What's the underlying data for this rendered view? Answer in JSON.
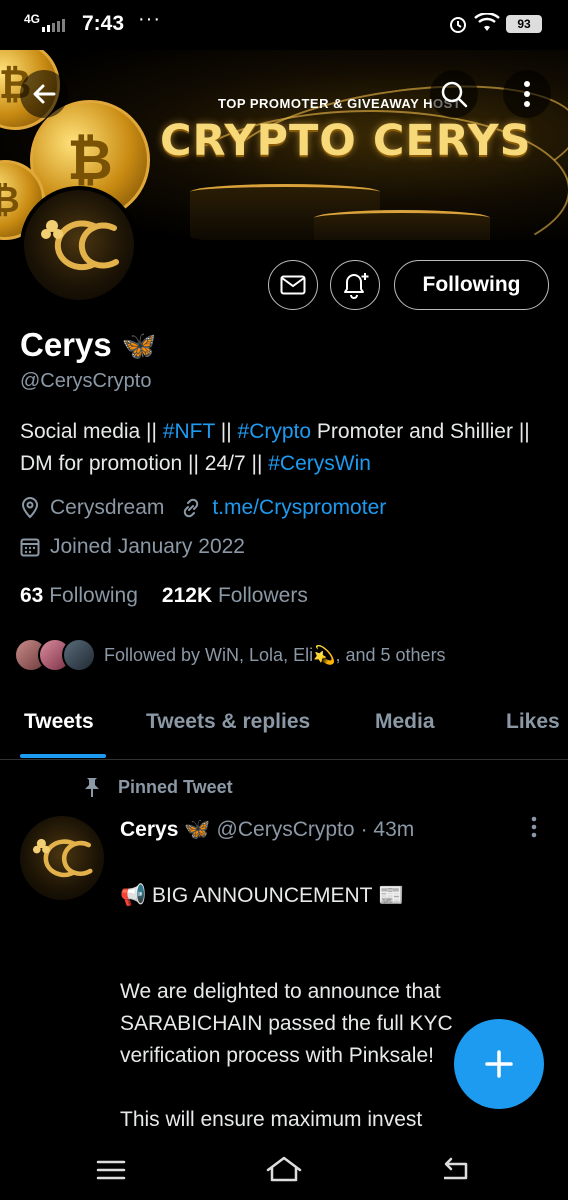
{
  "status_bar": {
    "network": "4G",
    "time": "7:43",
    "more": "···",
    "battery": "93"
  },
  "banner": {
    "subtitle": "TOP PROMOTER & GIVEAWAY HOST",
    "title": "CRYPTO CERYS"
  },
  "profile": {
    "name": "Cerys",
    "name_emoji": "🦋",
    "handle": "@CerysCrypto",
    "bio": {
      "p1": "Social media || ",
      "tag1": "#NFT",
      "p2": " || ",
      "tag2": "#Crypto",
      "p3": " Promoter and Shillier || DM for promotion || 24/7 || ",
      "tag3": "#CerysWin"
    },
    "location": "Cerysdream",
    "link": "t.me/Cryspromoter",
    "joined": "Joined January 2022",
    "following_count": "63",
    "following_label": "Following",
    "followers_count": "212K",
    "followers_label": "Followers",
    "followed_by": "Followed by WiN, Lola, Eli💫, and 5 others",
    "follow_button": "Following"
  },
  "tabs": [
    "Tweets",
    "Tweets & replies",
    "Media",
    "Likes"
  ],
  "pinned_label": "Pinned Tweet",
  "tweet": {
    "author": "Cerys",
    "author_emoji": "🦋",
    "handle": "@CerysCrypto",
    "time": "· 43m",
    "line1": "📢 BIG ANNOUNCEMENT 📰",
    "body": "We are delighted to announce that SARABICHAIN passed the full KYC verification process with Pinksale!\n\nThis will ensure maximum invest       \nconfidence and give us the all im       t\nKYC badge when our presale goes live."
  },
  "colors": {
    "accent": "#1d9bf0",
    "muted": "#8b98a5",
    "gold": "#d9a23a"
  },
  "icons": [
    "back-arrow-icon",
    "search-icon",
    "more-vertical-icon",
    "mail-icon",
    "bell-plus-icon",
    "location-icon",
    "link-icon",
    "calendar-icon",
    "pin-icon",
    "compose-plus-icon",
    "menu-icon",
    "home-icon",
    "back-icon"
  ]
}
